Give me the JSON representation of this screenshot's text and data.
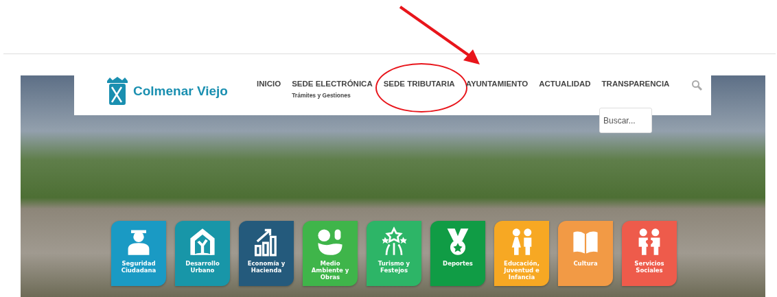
{
  "site": {
    "name": "Colmenar Viejo"
  },
  "nav": [
    {
      "label": "INICIO",
      "circled": false
    },
    {
      "label": "SEDE ELECTRÓNICA",
      "subtitle": "Trámites y Gestiones",
      "circled": false
    },
    {
      "label": "SEDE TRIBUTARIA",
      "circled": true
    },
    {
      "label": "AYUNTAMIENTO",
      "circled": false
    },
    {
      "label": "ACTUALIDAD",
      "circled": false
    },
    {
      "label": "TRANSPARENCIA",
      "circled": false
    }
  ],
  "search": {
    "placeholder": "Buscar..."
  },
  "tiles": [
    {
      "label": "Seguridad Ciudadana",
      "color": "#1a9ac4"
    },
    {
      "label": "Desarrollo Urbano",
      "color": "#1896a8"
    },
    {
      "label": "Economía y Hacienda",
      "color": "#245a7c"
    },
    {
      "label": "Medio Ambiente y Obras",
      "color": "#3fb54a"
    },
    {
      "label": "Turismo y Festejos",
      "color": "#2db567"
    },
    {
      "label": "Deportes",
      "color": "#109c45"
    },
    {
      "label": "Educación, Juventud e Infancia",
      "color": "#f7a823"
    },
    {
      "label": "Cultura",
      "color": "#f29a45"
    },
    {
      "label": "Servicios Sociales",
      "color": "#ee5b4b"
    }
  ]
}
